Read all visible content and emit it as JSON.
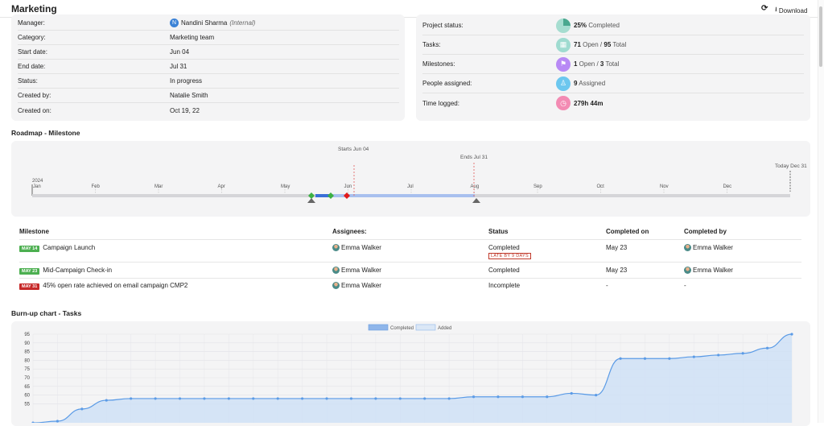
{
  "header": {
    "title": "Marketing",
    "download_label": "Download"
  },
  "details": [
    {
      "label": "Manager:",
      "value": "Nandini Sharma",
      "note": "(Internal)",
      "avatar": "N"
    },
    {
      "label": "Category:",
      "value": "Marketing team"
    },
    {
      "label": "Start date:",
      "value": "Jun 04"
    },
    {
      "label": "End date:",
      "value": "Jul 31"
    },
    {
      "label": "Status:",
      "value": "In progress"
    },
    {
      "label": "Created by:",
      "value": "Natalie Smith"
    },
    {
      "label": "Created on:",
      "value": "Oct 19, 22"
    }
  ],
  "stats": [
    {
      "label": "Project status:",
      "bold": "25%",
      "rest": " Completed",
      "icon": "pie-icon",
      "color": "#8fd5c4"
    },
    {
      "label": "Tasks:",
      "bold": "71",
      "rest": " Open / ",
      "bold2": "95",
      "rest2": " Total",
      "icon": "list-icon",
      "color": "#9fdbd0"
    },
    {
      "label": "Milestones:",
      "bold": "1",
      "rest": " Open / ",
      "bold2": "3",
      "rest2": " Total",
      "icon": "flag-icon",
      "color": "#b889f5"
    },
    {
      "label": "People assigned:",
      "bold": "9",
      "rest": " Assigned",
      "icon": "person-icon",
      "color": "#6cc7ef"
    },
    {
      "label": "Time logged:",
      "bold": "279h 44m",
      "rest": "",
      "icon": "clock-icon",
      "color": "#f38bb3"
    }
  ],
  "roadmap": {
    "title": "Roadmap - Milestone",
    "year": "2024",
    "months": [
      "Jan",
      "Feb",
      "Mar",
      "Apr",
      "May",
      "Jun",
      "Jul",
      "Aug",
      "Sep",
      "Oct",
      "Nov",
      "Dec"
    ],
    "start_label": "Starts Jun 04",
    "end_label": "Ends Jul 31",
    "today_label": "Today Dec 31"
  },
  "milestone_table": {
    "headers": [
      "Milestone",
      "Assignees:",
      "Status",
      "Completed on",
      "Completed by"
    ],
    "rows": [
      {
        "date": "MAY 14",
        "badge_color": "#4caf50",
        "name": "Campaign Launch",
        "assignee": "Emma Walker",
        "status": "Completed",
        "late": "LATE BY 9 DAYS",
        "completed_on": "May 23",
        "completed_by": "Emma Walker"
      },
      {
        "date": "MAY 23",
        "badge_color": "#4caf50",
        "name": "Mid-Campaign Check-in",
        "assignee": "Emma Walker",
        "status": "Completed",
        "late": "",
        "completed_on": "May 23",
        "completed_by": "Emma Walker"
      },
      {
        "date": "MAY 31",
        "badge_color": "#c62828",
        "name": "45% open rate achieved on email campaign CMP2",
        "assignee": "Emma Walker",
        "status": "Incomplete",
        "late": "",
        "completed_on": "-",
        "completed_by": "-"
      }
    ]
  },
  "burnup": {
    "title": "Burn-up chart - Tasks",
    "legend": [
      "Completed",
      "Added"
    ]
  },
  "chart_data": {
    "type": "area",
    "title": "",
    "xlabel": "",
    "ylabel": "",
    "ylim": [
      50,
      95
    ],
    "yticks": [
      95,
      90,
      85,
      80,
      75,
      70,
      65,
      60,
      55
    ],
    "series": [
      {
        "name": "Added",
        "values": [
          44,
          45,
          52,
          57,
          58,
          58,
          58,
          58,
          58,
          58,
          58,
          58,
          58,
          58,
          58,
          58,
          58,
          58,
          59,
          59,
          59,
          59,
          61,
          60,
          81,
          81,
          81,
          82,
          83,
          84,
          87,
          95
        ]
      }
    ]
  }
}
